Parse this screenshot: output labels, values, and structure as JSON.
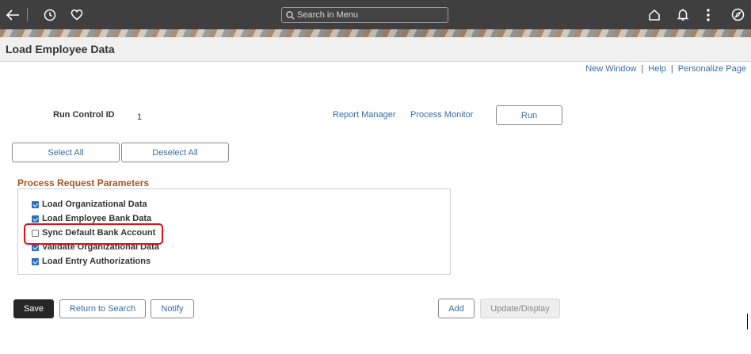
{
  "topbar": {
    "search_placeholder": "Search in Menu",
    "icons": [
      "back-arrow-icon",
      "recent-clock-icon",
      "favorites-heart-icon",
      "home-icon",
      "notifications-bell-icon",
      "actions-kebab-icon",
      "navbar-compass-icon"
    ],
    "background": "#3f3f3f"
  },
  "page": {
    "title": "Load Employee Data"
  },
  "links": {
    "new_window": "New Window",
    "help": "Help",
    "personalize": "Personalize Page",
    "separator": "|"
  },
  "run_control": {
    "label": "Run Control ID",
    "value": "1",
    "report_manager": "Report Manager",
    "process_monitor": "Process Monitor",
    "run_button": "Run"
  },
  "selection": {
    "select_all": "Select All",
    "deselect_all": "Deselect All"
  },
  "parameters": {
    "title": "Process Request Parameters",
    "title_color": "#a9541b",
    "items": [
      {
        "label": "Load Organizational Data",
        "checked": true
      },
      {
        "label": "Load Employee Bank Data",
        "checked": true
      },
      {
        "label": "Sync Default Bank Account",
        "checked": false
      },
      {
        "label": "Validate Organizational Data",
        "checked": true
      },
      {
        "label": "Load Entry Authorizations",
        "checked": true
      }
    ],
    "highlight_color": "#e0101a"
  },
  "footer": {
    "save": "Save",
    "return_to_search": "Return to Search",
    "notify": "Notify",
    "add": "Add",
    "update_display": "Update/Display"
  }
}
